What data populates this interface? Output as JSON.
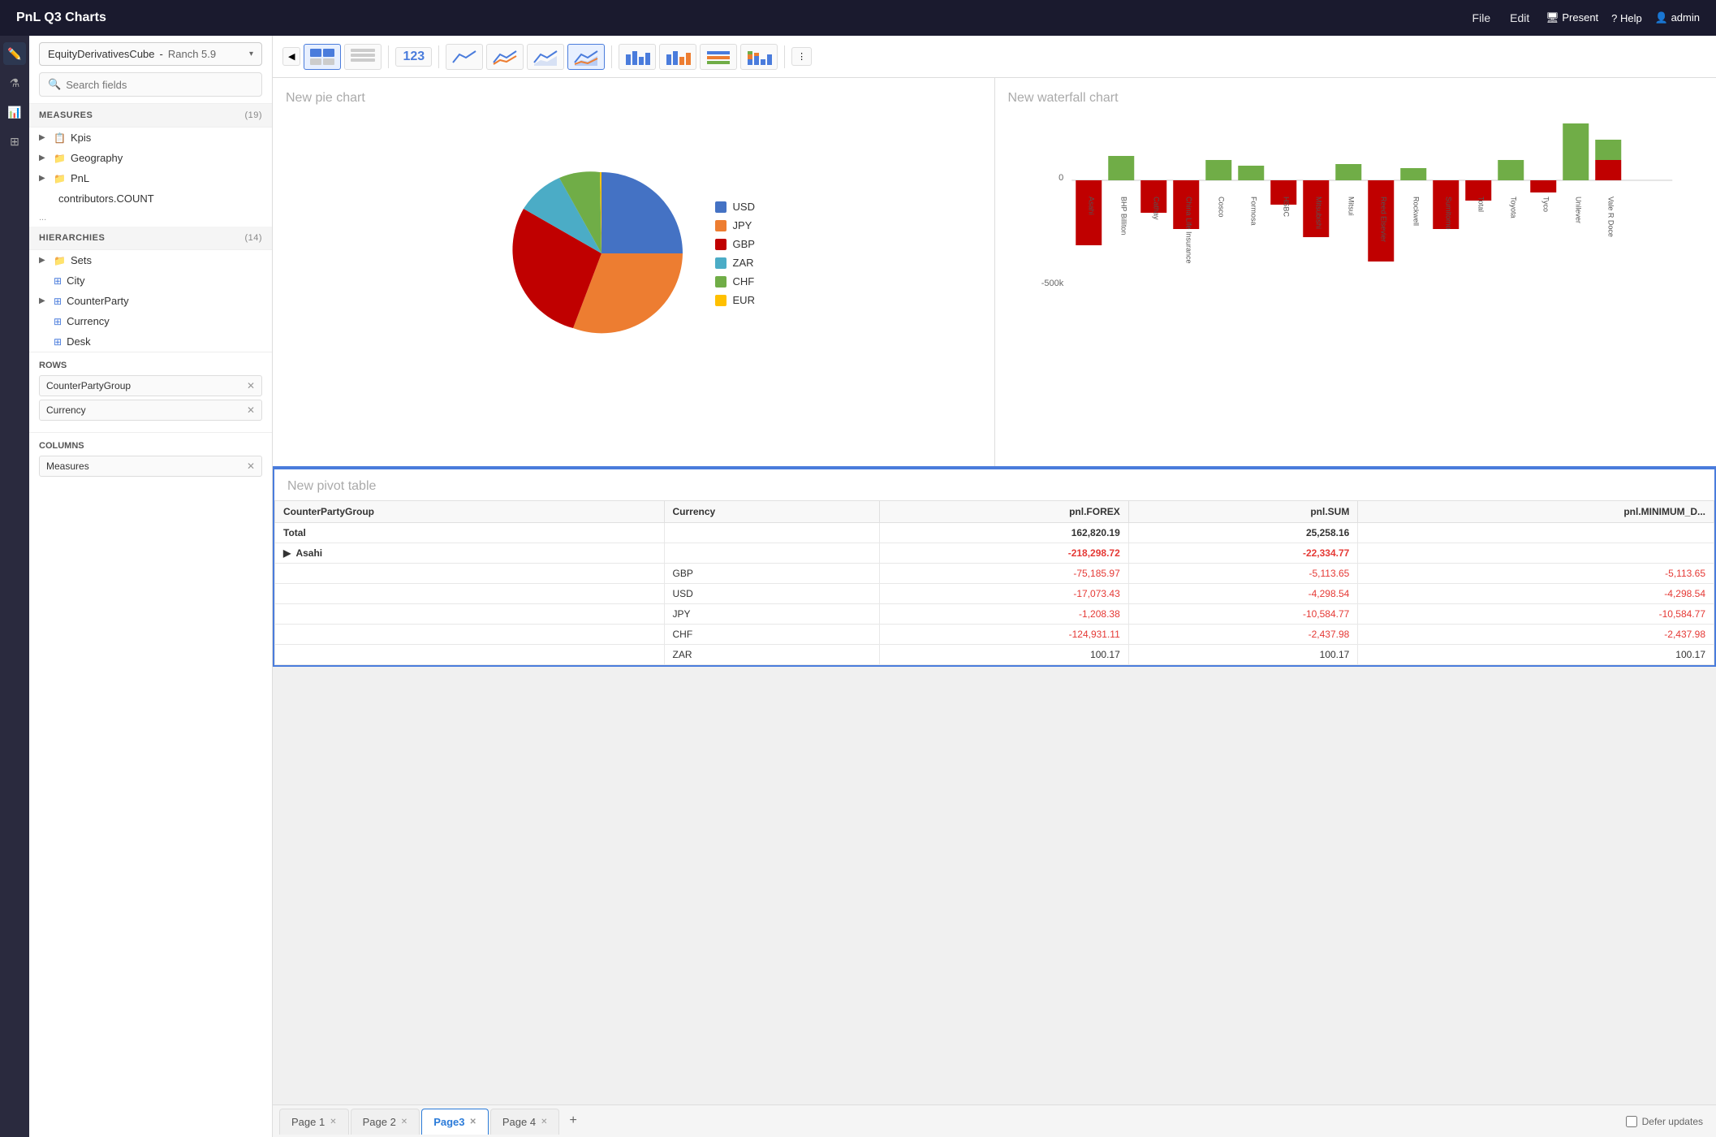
{
  "app": {
    "title": "PnL Q3 Charts",
    "nav": [
      "File",
      "Edit"
    ],
    "right_nav": [
      "Present",
      "Help",
      "admin"
    ]
  },
  "sidebar": {
    "cube_name": "EquityDerivativesCube",
    "cube_separator": " - ",
    "cube_version": "Ranch 5.9",
    "search_placeholder": "Search fields",
    "measures_section": "MEASURES",
    "measures_count": "(19)",
    "hierarchies_section": "HIERARCHIES",
    "hierarchies_count": "(14)",
    "measures_items": [
      {
        "label": "Kpis",
        "icon": "📋",
        "expandable": true
      },
      {
        "label": "Geography",
        "icon": "📁",
        "expandable": true
      },
      {
        "label": "PnL",
        "icon": "📁",
        "expandable": true
      },
      {
        "label": "contributors.COUNT",
        "icon": "",
        "expandable": false
      },
      {
        "label": "...",
        "icon": "",
        "expandable": false
      }
    ],
    "hierarchies_items": [
      {
        "label": "Sets",
        "icon": "📁",
        "expandable": true
      },
      {
        "label": "City",
        "icon": "🏙",
        "expandable": false
      },
      {
        "label": "CounterParty",
        "icon": "🏙",
        "expandable": true
      },
      {
        "label": "Currency",
        "icon": "🏙",
        "expandable": false
      },
      {
        "label": "Desk",
        "icon": "🏙",
        "expandable": false
      }
    ],
    "rows_label": "Rows",
    "rows_tags": [
      "CounterPartyGroup",
      "Currency"
    ],
    "columns_label": "Columns",
    "columns_tags": [
      "Measures"
    ]
  },
  "toolbar": {
    "buttons": [
      "table",
      "pivot",
      "number",
      "line1",
      "line2",
      "line3",
      "line4",
      "bar1",
      "bar2",
      "bar3",
      "bar4",
      "more"
    ]
  },
  "pie_chart": {
    "title": "New pie chart",
    "legend": [
      {
        "label": "USD",
        "color": "#4472C4"
      },
      {
        "label": "JPY",
        "color": "#ED7D31"
      },
      {
        "label": "GBP",
        "color": "#C00000"
      },
      {
        "label": "ZAR",
        "color": "#4BACC6"
      },
      {
        "label": "CHF",
        "color": "#70AD47"
      },
      {
        "label": "EUR",
        "color": "#FFC000"
      }
    ]
  },
  "waterfall_chart": {
    "title": "New waterfall chart",
    "zero_label": "0",
    "neg_label": "-500k",
    "x_labels": [
      "Asahi",
      "BHP Billiton",
      "Cathay",
      "China Life Insurance",
      "Cosco",
      "Formosa",
      "HSBC",
      "Mitsubishi",
      "Mitsui",
      "Reed Elsevier",
      "Rockwell",
      "Sumitomo",
      "Total",
      "Toyota",
      "Tyco",
      "Unilever",
      "Vale R Doce"
    ]
  },
  "pivot_table": {
    "title": "New pivot table",
    "columns": [
      "CounterPartyGroup",
      "Currency",
      "pnl.FOREX",
      "pnl.SUM",
      "pnl.MINIMUM_D..."
    ],
    "rows": [
      {
        "group": "Total",
        "currency": "",
        "forex": "162,820.19",
        "sum": "25,258.16",
        "min": "",
        "is_total": true,
        "negative": false
      },
      {
        "group": "▶  Asahi",
        "currency": "",
        "forex": "-218,298.72",
        "sum": "-22,334.77",
        "min": "",
        "is_group": true,
        "negative": true
      },
      {
        "group": "",
        "currency": "GBP",
        "forex": "-75,185.97",
        "sum": "-5,113.65",
        "min": "-5,113.65",
        "negative": true
      },
      {
        "group": "",
        "currency": "USD",
        "forex": "-17,073.43",
        "sum": "-4,298.54",
        "min": "-4,298.54",
        "negative": true
      },
      {
        "group": "",
        "currency": "JPY",
        "forex": "-1,208.38",
        "sum": "-10,584.77",
        "min": "-10,584.77",
        "negative": true
      },
      {
        "group": "",
        "currency": "CHF",
        "forex": "-124,931.11",
        "sum": "-2,437.98",
        "min": "-2,437.98",
        "negative": true
      },
      {
        "group": "",
        "currency": "ZAR",
        "forex": "100.17",
        "sum": "100.17",
        "min": "100.17",
        "negative": false
      }
    ]
  },
  "tabs": {
    "items": [
      {
        "label": "Page 1",
        "active": false
      },
      {
        "label": "Page 2",
        "active": false
      },
      {
        "label": "Page3",
        "active": true
      },
      {
        "label": "Page 4",
        "active": false
      }
    ],
    "add_label": "+",
    "defer_label": "Defer updates"
  }
}
